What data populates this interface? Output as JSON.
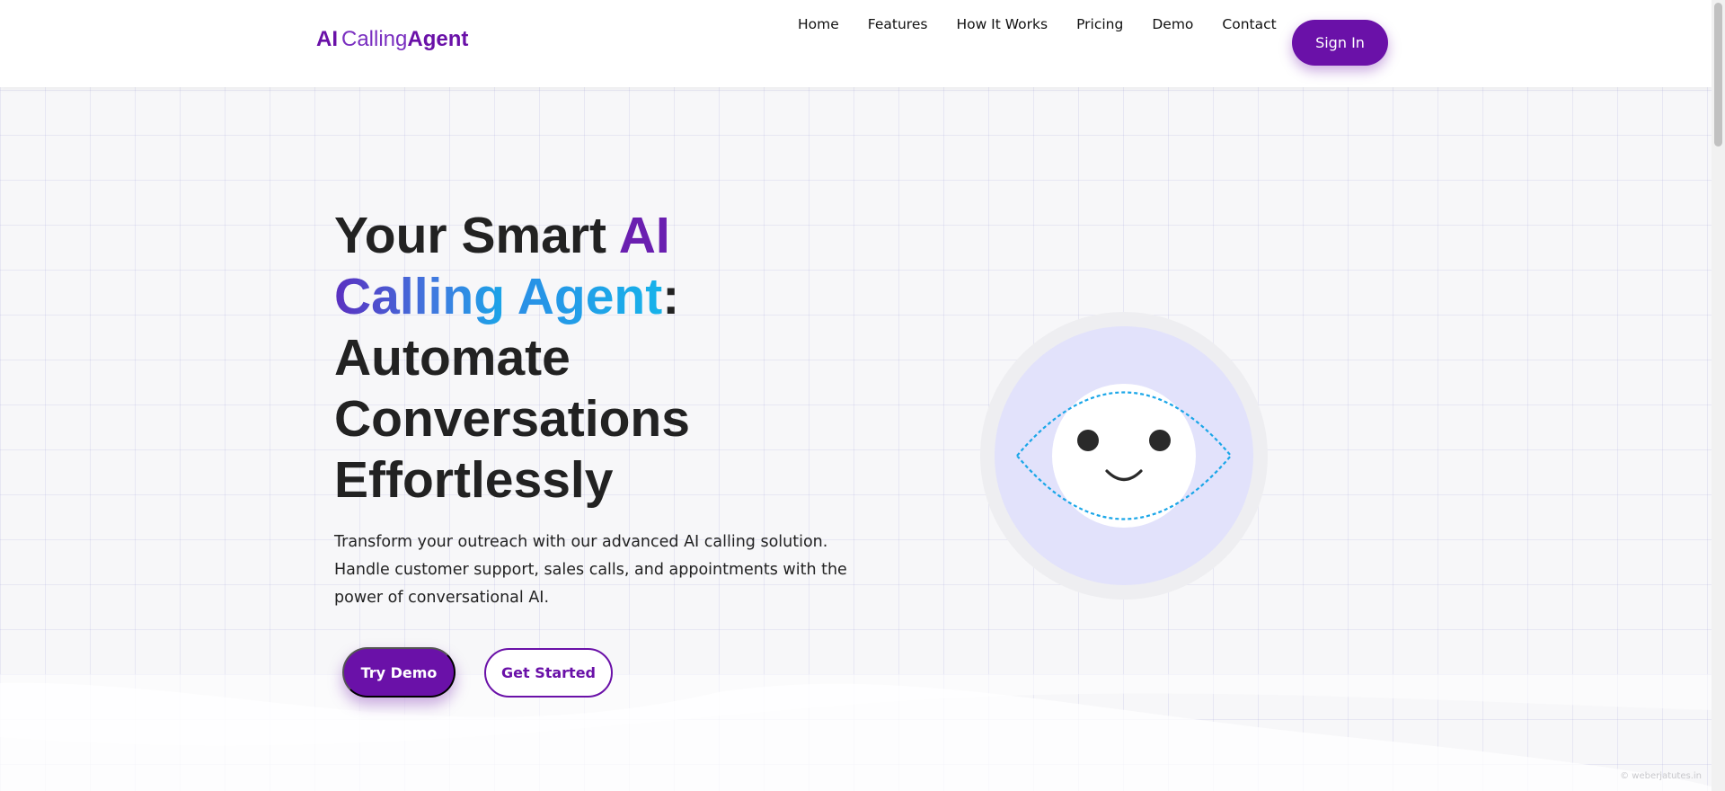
{
  "brand": {
    "part1": "AI",
    "part2": "Calling",
    "part3": "Agent"
  },
  "nav": [
    {
      "label": "Home"
    },
    {
      "label": "Features"
    },
    {
      "label": "How It Works"
    },
    {
      "label": "Pricing"
    },
    {
      "label": "Demo"
    },
    {
      "label": "Contact"
    }
  ],
  "header": {
    "signin_label": "Sign In"
  },
  "hero": {
    "title_part1": "Your Smart ",
    "title_ai": "AI",
    "title_calling": "Calling",
    "title_agent": "Agent",
    "title_colon": ":",
    "title_line3": "Automate",
    "title_line4": "Conversations",
    "title_line5": "Effortlessly",
    "description": "Transform your outreach with our advanced AI calling solution. Handle customer support, sales calls, and appointments with the power of conversational AI.",
    "primary_button": "Try Demo",
    "secondary_button": "Get Started"
  },
  "illustration": {
    "icon": "smiling-robot-face-icon"
  },
  "footer_watermark": "© weberjatutes.in",
  "colors": {
    "brand_purple": "#6a11a8",
    "accent_blue": "#17b3ea",
    "face_ring": "#e4e4fb",
    "dashed_eye": "#1aa6e8"
  }
}
